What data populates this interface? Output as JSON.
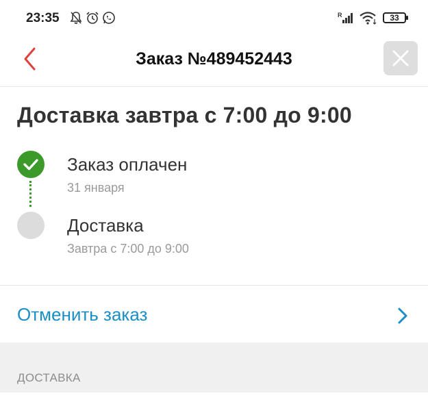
{
  "status_bar": {
    "time": "23:35",
    "left_icons": [
      "bell-off-icon",
      "alarm-icon",
      "whatsapp-icon"
    ],
    "signal_badge": "R",
    "battery": "33"
  },
  "header": {
    "title": "Заказ №489452443",
    "back_icon": "chevron-left-icon",
    "close_icon": "close-icon"
  },
  "delivery": {
    "heading": "Доставка завтра с 7:00 до 9:00",
    "steps": [
      {
        "title": "Заказ оплачен",
        "subtitle": "31 января",
        "state": "done"
      },
      {
        "title": "Доставка",
        "subtitle": "Завтра с 7:00 до 9:00",
        "state": "pending"
      }
    ]
  },
  "actions": {
    "cancel_label": "Отменить заказ"
  },
  "section": {
    "label": "ДОСТАВКА"
  },
  "colors": {
    "accent_red": "#e0403c",
    "success_green": "#3c9a2a",
    "link_blue": "#1a8ec7"
  }
}
